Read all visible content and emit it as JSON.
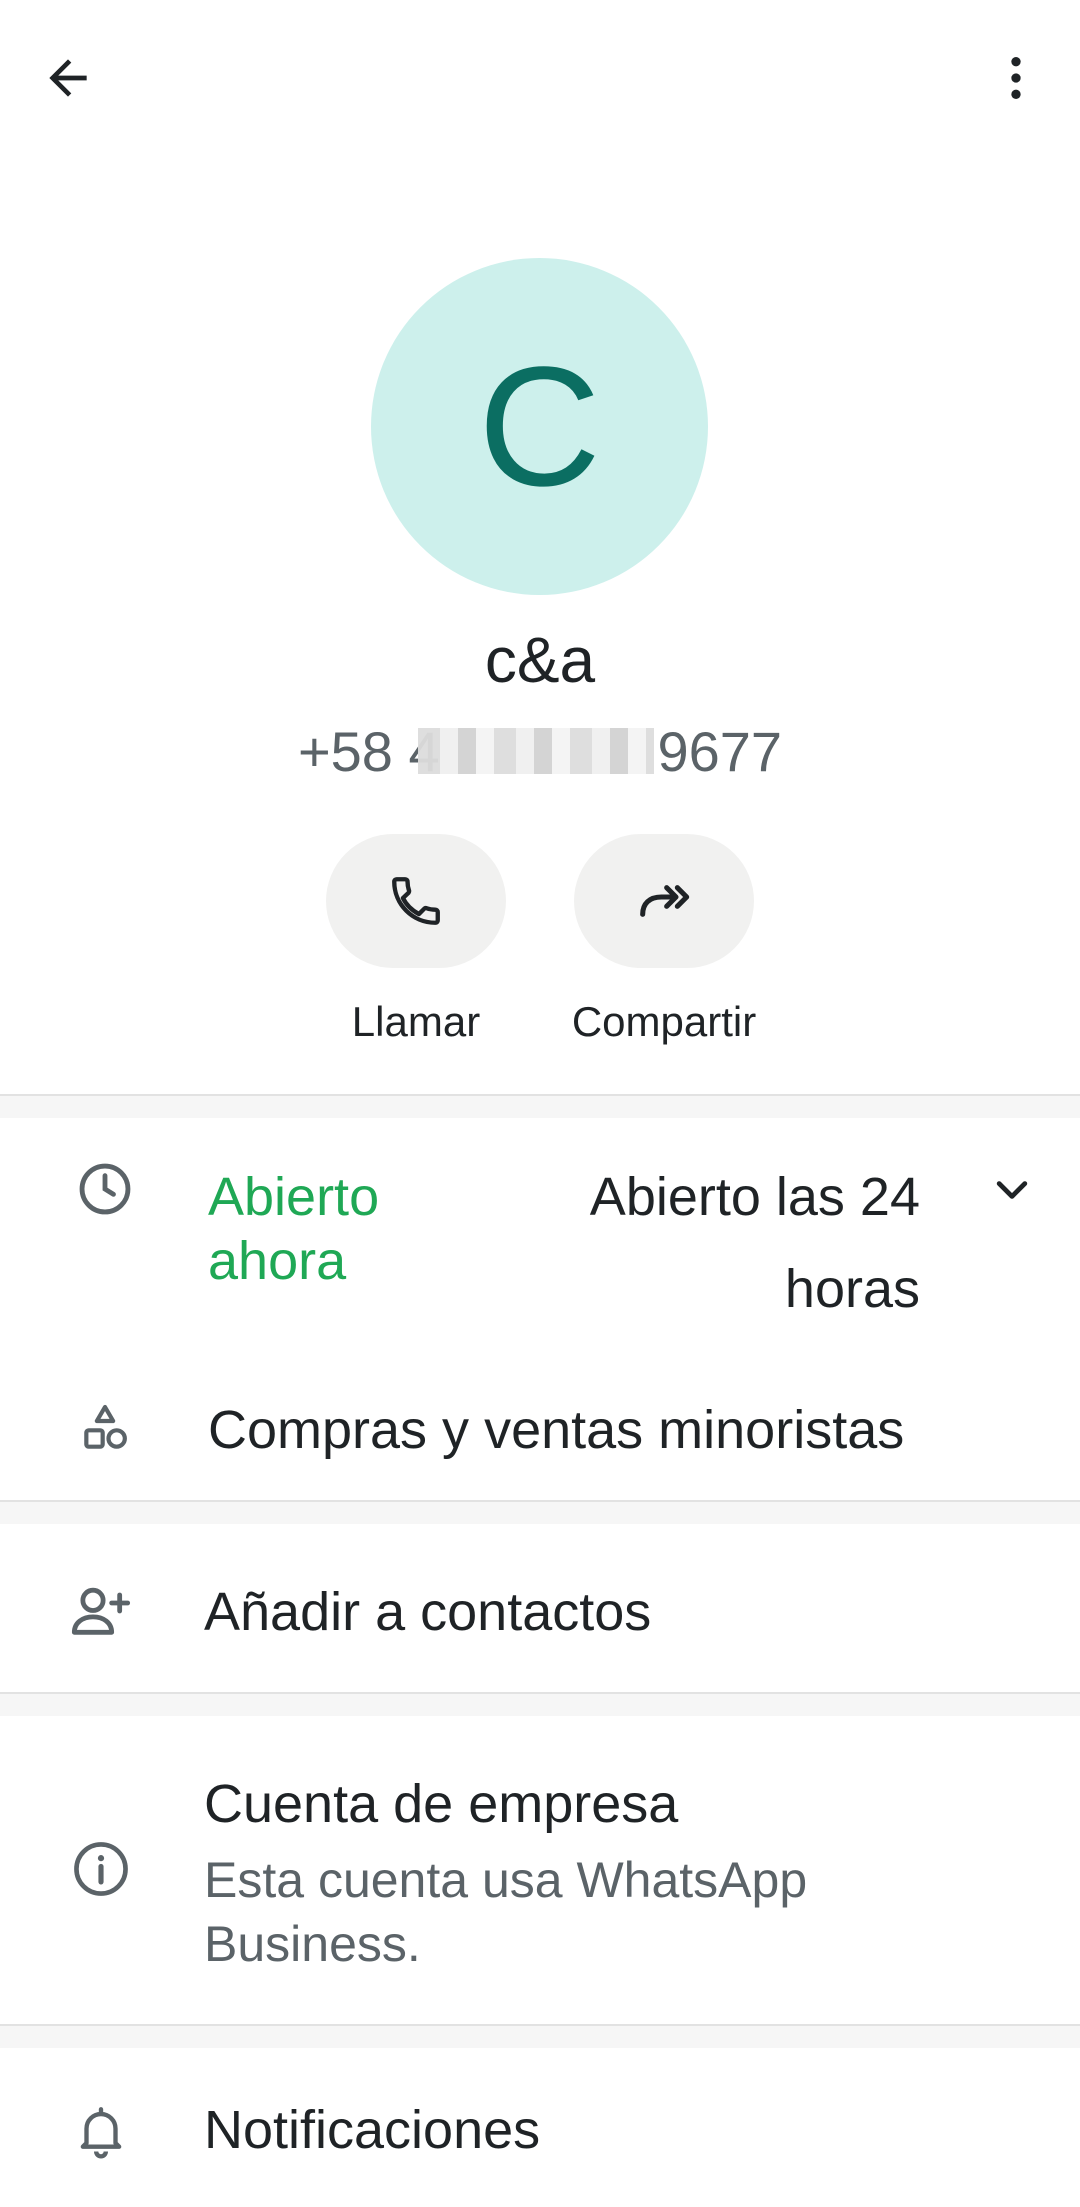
{
  "header": {
    "back_icon": "arrow-left-icon",
    "menu_icon": "more-vertical-icon"
  },
  "profile": {
    "avatar_letter": "C",
    "avatar_bg": "#cdf0ec",
    "avatar_fg": "#0b6e62",
    "name": "c&a",
    "phone": "+58 4              9677"
  },
  "actions": [
    {
      "label": "Llamar",
      "icon": "phone-icon"
    },
    {
      "label": "Compartir",
      "icon": "share-forward-icon"
    }
  ],
  "hours": {
    "status": "Abierto ahora",
    "status_color": "#1fa855",
    "detail": "Abierto las 24 horas",
    "icon": "clock-icon",
    "expand_icon": "chevron-down-icon"
  },
  "category": {
    "label": "Compras y ventas minoristas",
    "icon": "shapes-icon"
  },
  "add_contact": {
    "label": "Añadir a contactos",
    "icon": "add-person-icon"
  },
  "business": {
    "title": "Cuenta de empresa",
    "subtitle": "Esta cuenta usa WhatsApp Business.",
    "icon": "info-icon"
  },
  "notifications": {
    "label": "Notificaciones",
    "icon": "bell-icon"
  }
}
